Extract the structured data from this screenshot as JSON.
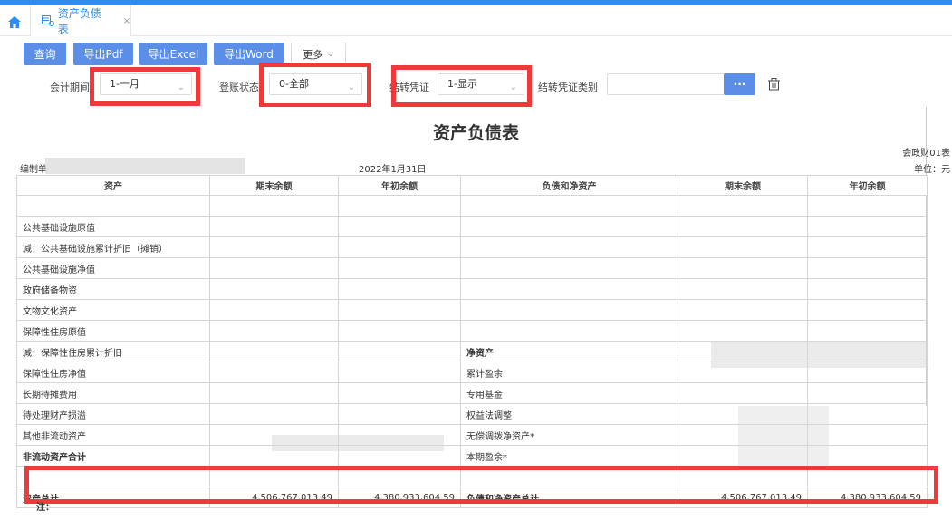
{
  "colors": {
    "accent": "#2d8cf0",
    "button": "#5b8ee6",
    "highlight": "#ee3a3a"
  },
  "tab": {
    "icon": "report-tab-icon",
    "label": "资产负债表",
    "close": "×"
  },
  "toolbar": {
    "query": "查询",
    "export_pdf": "导出Pdf",
    "export_excel": "导出Excel",
    "export_word": "导出Word",
    "more": "更多"
  },
  "filters": {
    "period_label": "会计期间",
    "period_value": "1-一月",
    "status_label": "登账状态",
    "status_value": "0-全部",
    "carry_label": "结转凭证",
    "carry_value": "1-显示",
    "carry_type_label": "结转凭证类别",
    "carry_type_value": "",
    "dots": "···"
  },
  "report": {
    "title": "资产负债表",
    "code": "会政财01表",
    "company_label": "编制单",
    "date": "2022年1月31日",
    "unit": "单位：元",
    "headers": [
      "资产",
      "期末余额",
      "年初余额",
      "负债和净资产",
      "期末余额",
      "年初余额"
    ],
    "rows": [
      {
        "a": "",
        "a_indent": 0,
        "a_bold": false,
        "a_end": "",
        "a_begin": "",
        "l": "",
        "l_indent": 0,
        "l_bold": false,
        "l_end": "",
        "l_begin": ""
      },
      {
        "a": "公共基础设施原值",
        "a_indent": 0,
        "a_bold": false,
        "a_end": "",
        "a_begin": "",
        "l": "",
        "l_indent": 0,
        "l_bold": false,
        "l_end": "",
        "l_begin": ""
      },
      {
        "a": "减：公共基础设施累计折旧（摊销）",
        "a_indent": 1,
        "a_bold": false,
        "a_end": "",
        "a_begin": "",
        "l": "",
        "l_indent": 0,
        "l_bold": false,
        "l_end": "",
        "l_begin": ""
      },
      {
        "a": "公共基础设施净值",
        "a_indent": 1,
        "a_bold": false,
        "a_end": "",
        "a_begin": "",
        "l": "",
        "l_indent": 0,
        "l_bold": false,
        "l_end": "",
        "l_begin": ""
      },
      {
        "a": "政府储备物资",
        "a_indent": 0,
        "a_bold": false,
        "a_end": "",
        "a_begin": "",
        "l": "",
        "l_indent": 0,
        "l_bold": false,
        "l_end": "",
        "l_begin": ""
      },
      {
        "a": "文物文化资产",
        "a_indent": 0,
        "a_bold": false,
        "a_end": "",
        "a_begin": "",
        "l": "",
        "l_indent": 0,
        "l_bold": false,
        "l_end": "",
        "l_begin": ""
      },
      {
        "a": "保障性住房原值",
        "a_indent": 0,
        "a_bold": false,
        "a_end": "",
        "a_begin": "",
        "l": "",
        "l_indent": 0,
        "l_bold": false,
        "l_end": "",
        "l_begin": ""
      },
      {
        "a": "减：保障性住房累计折旧",
        "a_indent": 1,
        "a_bold": false,
        "a_end": "",
        "a_begin": "",
        "l": "净资产",
        "l_indent": 0,
        "l_bold": true,
        "l_end": "",
        "l_begin": ""
      },
      {
        "a": "保障性住房净值",
        "a_indent": 1,
        "a_bold": false,
        "a_end": "",
        "a_begin": "",
        "l": "累计盈余",
        "l_indent": 1,
        "l_bold": false,
        "l_end": "",
        "l_begin": ""
      },
      {
        "a": "长期待摊费用",
        "a_indent": 0,
        "a_bold": false,
        "a_end": "",
        "a_begin": "",
        "l": "专用基金",
        "l_indent": 1,
        "l_bold": false,
        "l_end": "",
        "l_begin": ""
      },
      {
        "a": "待处理财产损溢",
        "a_indent": 0,
        "a_bold": false,
        "a_end": "",
        "a_begin": "",
        "l": "权益法调整",
        "l_indent": 1,
        "l_bold": false,
        "l_end": "",
        "l_begin": ""
      },
      {
        "a": "其他非流动资产",
        "a_indent": 0,
        "a_bold": false,
        "a_end": "",
        "a_begin": "",
        "l": "无偿调拨净资产*",
        "l_indent": 1,
        "l_bold": false,
        "l_end": "",
        "l_begin": ""
      },
      {
        "a": "非流动资产合计",
        "a_indent": 2,
        "a_bold": true,
        "a_end": "",
        "a_begin": "",
        "l": "本期盈余*",
        "l_indent": 1,
        "l_bold": false,
        "l_end": "",
        "l_begin": ""
      },
      {
        "a": "",
        "a_indent": 0,
        "a_bold": false,
        "a_end": "",
        "a_begin": "",
        "l": "",
        "l_indent": 0,
        "l_bold": false,
        "l_end": "",
        "l_begin": ""
      },
      {
        "a": "资产总计",
        "a_indent": 2,
        "a_bold": true,
        "a_end": "4,506,767,013.49",
        "a_begin": "4,380,933,604.59",
        "l": "负债和净资产总计",
        "l_indent": 2,
        "l_bold": true,
        "l_end": "4,506,767,013.49",
        "l_begin": "4,380,933,604.59"
      }
    ],
    "note": "注："
  }
}
